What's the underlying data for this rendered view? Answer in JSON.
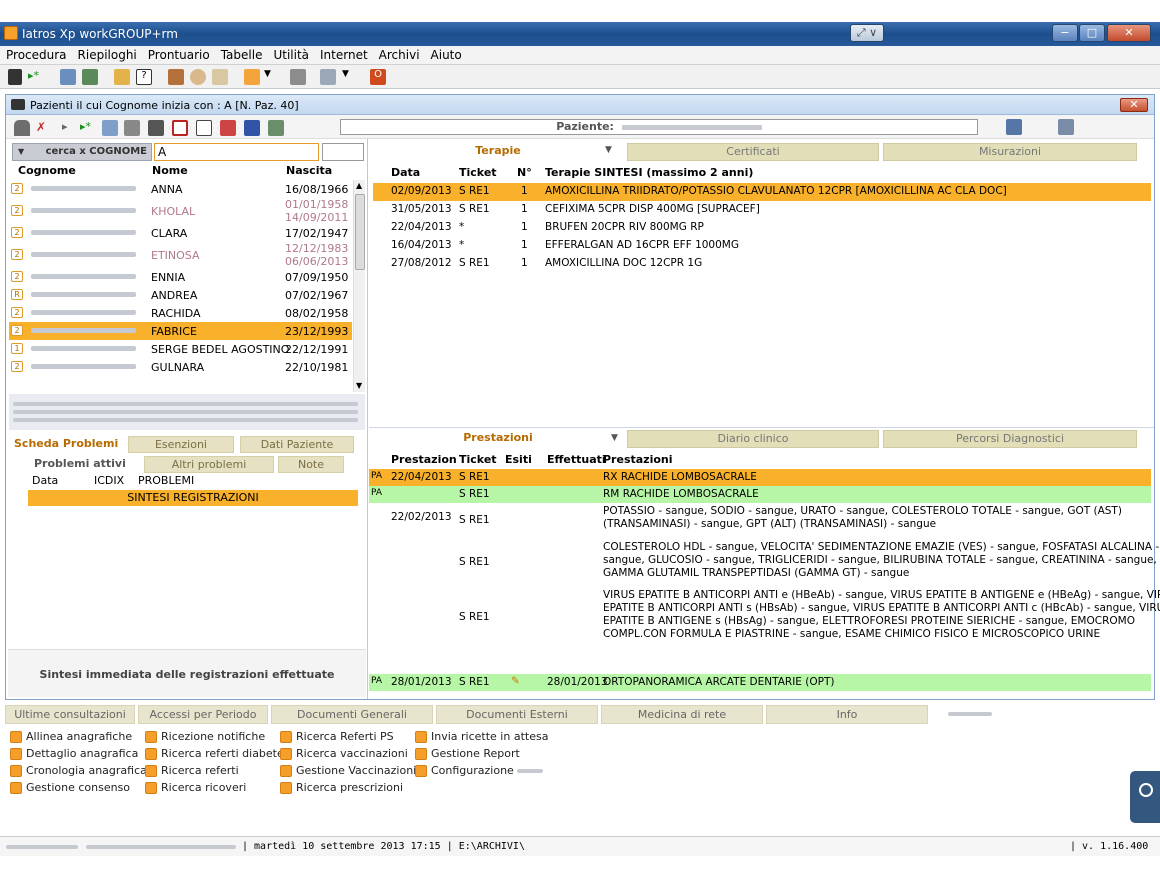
{
  "window": {
    "title": "Iatros Xp workGROUP+rm",
    "minimize": "−",
    "maximize": "□",
    "close": "✕"
  },
  "menu": [
    "Procedura",
    "Riepiloghi",
    "Prontuario",
    "Tabelle",
    "Utilità",
    "Internet",
    "Archivi",
    "Aiuto"
  ],
  "inner": {
    "title": "Pazienti il cui Cognome inizia con : A   [N. Paz. 40]",
    "close": "✕"
  },
  "paziente_label": "Paziente:",
  "search": {
    "label": "cerca x COGNOME",
    "value": "A"
  },
  "patients_header": {
    "cognome": "Cognome",
    "nome": "Nome",
    "nascita": "Nascita"
  },
  "patients": [
    {
      "icon": "2",
      "nome": "ANNA",
      "nascita": "16/08/1966",
      "nascita2": "",
      "muted": false,
      "selected": false
    },
    {
      "icon": "2",
      "nome": "KHOLAL",
      "nascita": "01/01/1958",
      "nascita2": "14/09/2011",
      "muted": true,
      "selected": false
    },
    {
      "icon": "2",
      "nome": "CLARA",
      "nascita": "17/02/1947",
      "nascita2": "",
      "muted": false,
      "selected": false
    },
    {
      "icon": "2",
      "nome": "ETINOSA",
      "nascita": "12/12/1983",
      "nascita2": "06/06/2013",
      "muted": true,
      "selected": false
    },
    {
      "icon": "2",
      "nome": "ENNIA",
      "nascita": "07/09/1950",
      "nascita2": "",
      "muted": false,
      "selected": false
    },
    {
      "icon": "R",
      "nome": "ANDREA",
      "nascita": "07/02/1967",
      "nascita2": "",
      "muted": false,
      "selected": false
    },
    {
      "icon": "2",
      "nome": "RACHIDA",
      "nascita": "08/02/1958",
      "nascita2": "",
      "muted": false,
      "selected": false
    },
    {
      "icon": "2",
      "nome": "FABRICE",
      "nascita": "23/12/1993",
      "nascita2": "",
      "muted": false,
      "selected": true
    },
    {
      "icon": "1",
      "nome": "SERGE BEDEL AGOSTINO",
      "nascita": "22/12/1991",
      "nascita2": "",
      "muted": false,
      "selected": false
    },
    {
      "icon": "2",
      "nome": "GULNARA",
      "nascita": "22/10/1981",
      "nascita2": "",
      "muted": false,
      "selected": false
    }
  ],
  "left_tabs": {
    "scheda": "Scheda Problemi",
    "esenzioni": "Esenzioni",
    "dati": "Dati Paziente"
  },
  "prob_tabs": {
    "attivi": "Problemi attivi",
    "altri": "Altri problemi",
    "note": "Note"
  },
  "prob_head": {
    "data": "Data",
    "icdix": "ICDIX",
    "problemi": "PROBLEMI"
  },
  "prob_selected": "SINTESI REGISTRAZIONI",
  "sintesi_text": "Sintesi immediata delle registrazioni effettuate",
  "right_tabs_top": {
    "terapie": "Terapie",
    "certificati": "Certificati",
    "misurazioni": "Misurazioni"
  },
  "ther_head": {
    "data": "Data",
    "ticket": "Ticket",
    "n": "N°",
    "sintesi": "Terapie SINTESI (massimo 2 anni)"
  },
  "therapies": [
    {
      "data": "02/09/2013",
      "ticket": "S RE1",
      "n": "1",
      "desc": "AMOXICILLINA TRIIDRATO/POTASSIO CLAVULANATO 12CPR [AMOXICILLINA AC CLA DOC]",
      "sel": true
    },
    {
      "data": "31/05/2013",
      "ticket": "S RE1",
      "n": "1",
      "desc": "CEFIXIMA 5CPR DISP 400MG [SUPRACEF]",
      "sel": false
    },
    {
      "data": "22/04/2013",
      "ticket": "*",
      "n": "1",
      "desc": "BRUFEN 20CPR RIV 800MG RP",
      "sel": false
    },
    {
      "data": "16/04/2013",
      "ticket": "*",
      "n": "1",
      "desc": "EFFERALGAN AD 16CPR EFF 1000MG",
      "sel": false
    },
    {
      "data": "27/08/2012",
      "ticket": "S RE1",
      "n": "1",
      "desc": "AMOXICILLINA DOC 12CPR 1G",
      "sel": false
    }
  ],
  "right_tabs_bottom": {
    "prestazioni": "Prestazioni",
    "diario": "Diario clinico",
    "percorsi": "Percorsi Diagnostici"
  },
  "prest_head": {
    "prestazion": "Prestazion",
    "ticket": "Ticket",
    "esiti": "Esiti",
    "effettuati": "Effettuati",
    "prestazioni": "Prestazioni"
  },
  "prestazioni": [
    {
      "pa": "PA",
      "data": "22/04/2013",
      "ticket": "S RE1",
      "eff": "",
      "desc": [
        "RX RACHIDE LOMBOSACRALE"
      ],
      "color": "orange"
    },
    {
      "pa": "PA",
      "data": "",
      "ticket": "S RE1",
      "eff": "",
      "desc": [
        "RM RACHIDE LOMBOSACRALE"
      ],
      "color": "green"
    },
    {
      "pa": "",
      "data": "22/02/2013",
      "ticket": "S RE1",
      "eff": "",
      "desc": [
        "POTASSIO - sangue, SODIO - sangue, URATO - sangue, COLESTEROLO TOTALE - sangue, GOT (AST)",
        "(TRANSAMINASI) - sangue, GPT (ALT) (TRANSAMINASI) - sangue"
      ],
      "color": ""
    },
    {
      "pa": "",
      "data": "",
      "ticket": "S RE1",
      "eff": "",
      "desc": [
        "COLESTEROLO HDL - sangue, VELOCITA' SEDIMENTAZIONE EMAZIE (VES) - sangue, FOSFATASI ALCALINA -",
        "sangue, GLUCOSIO - sangue, TRIGLICERIDI - sangue, BILIRUBINA TOTALE - sangue, CREATININA - sangue,",
        "GAMMA GLUTAMIL TRANSPEPTIDASI (GAMMA GT) - sangue"
      ],
      "color": ""
    },
    {
      "pa": "",
      "data": "",
      "ticket": "S RE1",
      "eff": "",
      "desc": [
        "VIRUS EPATITE B ANTICORPI ANTI e (HBeAb) - sangue, VIRUS EPATITE B ANTIGENE e (HBeAg) - sangue, VIRUS",
        "EPATITE B ANTICORPI ANTI s (HBsAb) - sangue, VIRUS EPATITE B ANTICORPI ANTI c (HBcAb) - sangue, VIRUS",
        "EPATITE B ANTIGENE s (HBsAg) - sangue, ELETTROFORESI PROTEINE SIERICHE - sangue, EMOCROMO",
        "COMPL.CON FORMULA E PIASTRINE - sangue, ESAME CHIMICO FISICO E MICROSCOPICO URINE"
      ],
      "color": ""
    },
    {
      "pa": "PA",
      "data": "28/01/2013",
      "ticket": "S RE1",
      "eff": "28/01/2013",
      "desc": [
        "ORTOPANORAMICA ARCATE DENTARIE (OPT)"
      ],
      "color": "green"
    }
  ],
  "bottom_tabs": [
    "Ultime consultazioni",
    "Accessi per Periodo",
    "Documenti Generali",
    "Documenti Esterni",
    "Medicina di rete",
    "Info"
  ],
  "links": [
    [
      "Allinea anagrafiche",
      "Dettaglio anagrafica",
      "Cronologia anagrafica",
      "Gestione consenso"
    ],
    [
      "Ricezione notifiche",
      "Ricerca referti diabete",
      "Ricerca referti",
      "Ricerca ricoveri"
    ],
    [
      "Ricerca Referti PS",
      "Ricerca vaccinazioni",
      "Gestione Vaccinazioni",
      "Ricerca prescrizioni"
    ],
    [
      "Invia ricette in attesa",
      "Gestione Report",
      "Configurazione"
    ]
  ],
  "status": {
    "datetime": "|  martedì 10 settembre 2013  17:15  |  E:\\ARCHIVI\\",
    "version": "|  v. 1.16.400"
  },
  "colors": {
    "accent_orange": "#f9b02a",
    "green_row": "#b7f6a6",
    "tab_beige": "#e2deb8",
    "title_blue": "#1d4e8c"
  }
}
